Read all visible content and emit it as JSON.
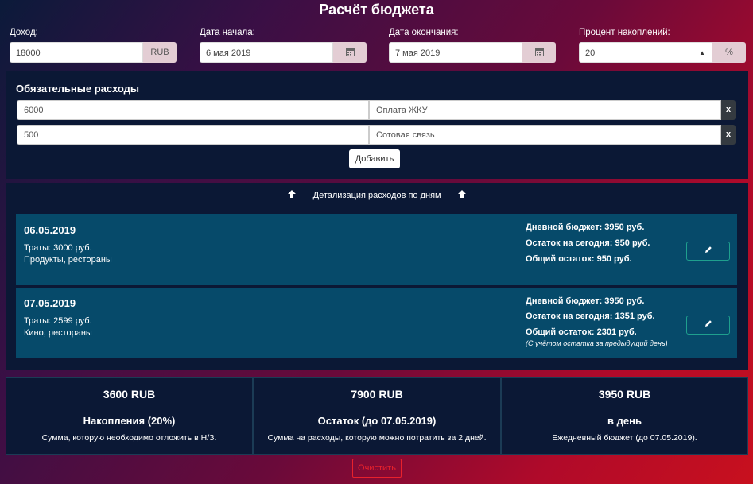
{
  "title": "Расчёт бюджета",
  "income": {
    "label": "Доход:",
    "value": "18000",
    "addon": "RUB"
  },
  "start_date": {
    "label": "Дата начала:",
    "value": "6 мая 2019"
  },
  "end_date": {
    "label": "Дата окончания:",
    "value": "7 мая 2019"
  },
  "savings_percent": {
    "label": "Процент накоплений:",
    "value": "20",
    "addon": "%"
  },
  "mandatory": {
    "header": "Обязательные расходы",
    "items": [
      {
        "amount": "6000",
        "name": "Оплата ЖКУ",
        "remove": "x"
      },
      {
        "amount": "500",
        "name": "Сотовая связь",
        "remove": "x"
      }
    ],
    "add_label": "Добавить"
  },
  "details": {
    "header": "Детализация расходов по дням",
    "days": [
      {
        "date": "06.05.2019",
        "spent": "Траты: 3000 руб.",
        "categories": "Продукты, рестораны",
        "daily_budget": "Дневной бюджет: 3950 руб.",
        "today_left": "Остаток на сегодня: 950 руб.",
        "total_left": "Общий остаток: 950 руб.",
        "note": ""
      },
      {
        "date": "07.05.2019",
        "spent": "Траты: 2599 руб.",
        "categories": "Кино, рестораны",
        "daily_budget": "Дневной бюджет: 3950 руб.",
        "today_left": "Остаток на сегодня: 1351 руб.",
        "total_left": "Общий остаток: 2301 руб.",
        "note": "(С учётом остатка за предыдущий день)"
      }
    ]
  },
  "summary": [
    {
      "value": "3600 RUB",
      "title": "Накопления (20%)",
      "desc": "Сумма, которую необходимо отложить в Н/З."
    },
    {
      "value": "7900 RUB",
      "title": "Остаток (до 07.05.2019)",
      "desc": "Сумма на расходы, которую можно потратить за 2 дней."
    },
    {
      "value": "3950 RUB",
      "title": "в день",
      "desc": "Ежедневный бюджет (до 07.05.2019)."
    }
  ],
  "clear_label": "Очистить",
  "icons": {
    "calendar": "calendar-icon",
    "arrow_up": "arrow-up-icon",
    "pencil": "pencil-icon",
    "sort": "sort-icon"
  }
}
